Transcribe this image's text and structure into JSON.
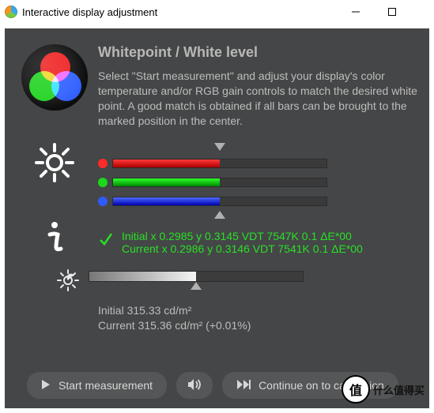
{
  "window": {
    "title": "Interactive display adjustment"
  },
  "header": {
    "title": "Whitepoint / White level",
    "description": "Select \"Start measurement\" and adjust your display's color temperature and/or RGB gain controls to match the desired white point. A good match is obtained if all bars can be brought to the marked position in the center."
  },
  "readout": {
    "initial": "Initial x 0.2985 y 0.3145 VDT 7547K 0.1 ΔE*00",
    "current": "Current x 0.2986 y 0.3146 VDT 7541K 0.1 ΔE*00"
  },
  "luminance": {
    "initial": "Initial 315.33 cd/m²",
    "current": "Current 315.36 cd/m² (+0.01%)"
  },
  "buttons": {
    "start": "Start measurement",
    "continue": "Continue on to calibration"
  },
  "watermark": {
    "badge": "值",
    "text": "什么值得买"
  }
}
